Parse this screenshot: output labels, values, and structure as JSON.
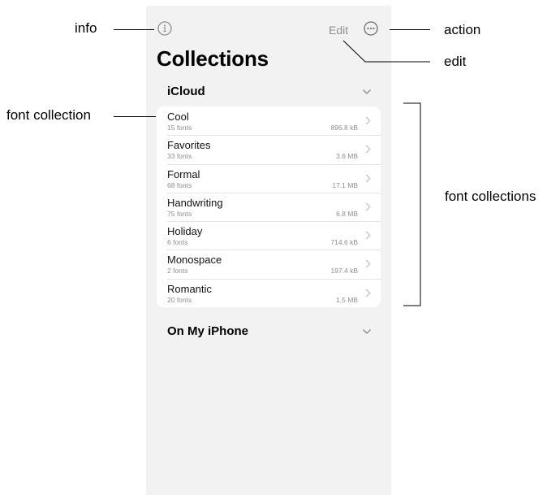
{
  "header": {
    "edit_label": "Edit",
    "title": "Collections"
  },
  "sections": [
    {
      "name": "iCloud",
      "collections": [
        {
          "name": "Cool",
          "count": "15 fonts",
          "size": "896.8 kB"
        },
        {
          "name": "Favorites",
          "count": "33 fonts",
          "size": "3.6 MB"
        },
        {
          "name": "Formal",
          "count": "68 fonts",
          "size": "17.1 MB"
        },
        {
          "name": "Handwriting",
          "count": "75 fonts",
          "size": "6.8 MB"
        },
        {
          "name": "Holiday",
          "count": "6 fonts",
          "size": "714.6 kB"
        },
        {
          "name": "Monospace",
          "count": "2 fonts",
          "size": "197.4 kB"
        },
        {
          "name": "Romantic",
          "count": "20 fonts",
          "size": "1.5 MB"
        }
      ]
    },
    {
      "name": "On My iPhone",
      "collections": []
    }
  ],
  "callouts": {
    "info": "info",
    "action": "action",
    "edit": "edit",
    "font_collection": "font collection",
    "font_collections": "font collections"
  },
  "icons": {
    "info": "info-circle-icon",
    "action": "ellipsis-circle-icon",
    "section_toggle": "chevron-down-icon",
    "row_disclosure": "chevron-right-icon"
  },
  "colors": {
    "background": "#f2f2f3",
    "card": "#ffffff",
    "secondary_text": "#8e8e93"
  }
}
